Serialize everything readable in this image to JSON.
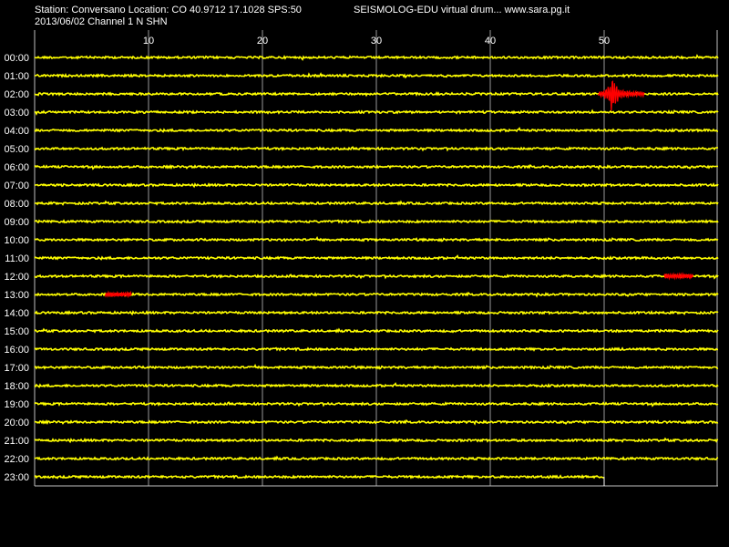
{
  "header": {
    "station_line": "Station: Conversano Location: CO 40.9712 17.1028 SPS:50",
    "date_line": "2013/06/02  Channel 1 N SHN",
    "app_line": "SEISMOLOG-EDU virtual drum... www.sara.pg.it"
  },
  "colors": {
    "background": "#000000",
    "trace": "#ffff00",
    "event": "#ff0000",
    "grid": "#c0c0c0",
    "text": "#ffffff"
  },
  "chart_data": {
    "type": "line",
    "x_ticks": [
      10,
      20,
      30,
      40,
      50
    ],
    "xlim": [
      0,
      60
    ],
    "x_unit": "minutes",
    "rows": [
      "00:00",
      "01:00",
      "02:00",
      "03:00",
      "04:00",
      "05:00",
      "06:00",
      "07:00",
      "08:00",
      "09:00",
      "10:00",
      "11:00",
      "12:00",
      "13:00",
      "14:00",
      "15:00",
      "16:00",
      "17:00",
      "18:00",
      "19:00",
      "20:00",
      "21:00",
      "22:00",
      "23:00"
    ],
    "last_row_end_minute": 50,
    "events": [
      {
        "row": "02:00",
        "start_min": 49.5,
        "end_min": 53.5,
        "peak_min": 50.6,
        "amplitude": "large"
      },
      {
        "row": "12:00",
        "start_min": 55.3,
        "end_min": 57.8,
        "amplitude": "small"
      },
      {
        "row": "13:00",
        "start_min": 6.2,
        "end_min": 8.5,
        "amplitude": "small"
      }
    ]
  }
}
